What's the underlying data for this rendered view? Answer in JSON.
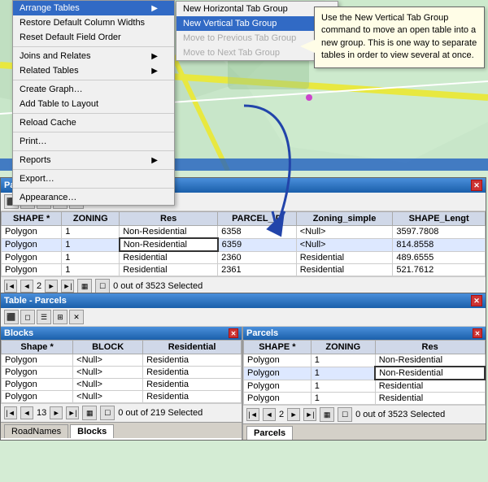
{
  "map": {
    "bg_color": "#c8e6c9"
  },
  "context_menu": {
    "items": [
      {
        "label": "Arrange Tables",
        "has_submenu": true,
        "disabled": false,
        "id": "arrange-tables"
      },
      {
        "label": "Restore Default Column Widths",
        "has_submenu": false,
        "disabled": false,
        "id": "restore-col"
      },
      {
        "label": "Reset Default Field Order",
        "has_submenu": false,
        "disabled": false,
        "id": "reset-field"
      },
      {
        "label": "separator",
        "id": "sep1"
      },
      {
        "label": "Joins and Relates",
        "has_submenu": true,
        "disabled": false,
        "id": "joins-relates"
      },
      {
        "label": "Related Tables",
        "has_submenu": true,
        "disabled": false,
        "id": "related-tables"
      },
      {
        "label": "separator",
        "id": "sep2"
      },
      {
        "label": "Create Graph…",
        "has_submenu": false,
        "disabled": false,
        "id": "create-graph"
      },
      {
        "label": "Add Table to Layout",
        "has_submenu": false,
        "disabled": false,
        "id": "add-table"
      },
      {
        "label": "separator",
        "id": "sep3"
      },
      {
        "label": "Reload Cache",
        "has_submenu": false,
        "disabled": false,
        "id": "reload"
      },
      {
        "label": "separator",
        "id": "sep4"
      },
      {
        "label": "Print…",
        "has_submenu": false,
        "disabled": false,
        "id": "print"
      },
      {
        "label": "separator",
        "id": "sep5"
      },
      {
        "label": "Reports",
        "has_submenu": true,
        "disabled": false,
        "id": "reports"
      },
      {
        "label": "separator",
        "id": "sep6"
      },
      {
        "label": "Export…",
        "has_submenu": false,
        "disabled": false,
        "id": "export"
      },
      {
        "label": "separator",
        "id": "sep7"
      },
      {
        "label": "Appearance…",
        "has_submenu": false,
        "disabled": false,
        "id": "appearance"
      }
    ],
    "submenu_arrange": {
      "items": [
        {
          "label": "New Horizontal Tab Group",
          "disabled": false
        },
        {
          "label": "New Vertical Tab Group",
          "disabled": false,
          "active": true
        },
        {
          "label": "Move to Previous Tab Group",
          "disabled": true
        },
        {
          "label": "Move to Next Tab Group",
          "disabled": true
        }
      ]
    }
  },
  "tooltip": {
    "text": "Use the New Vertical Tab Group command to move an open table into a new group.  This is one way to separate tables in order to view several at once."
  },
  "table_top": {
    "title": "Parcels",
    "columns": [
      "SHAPE *",
      "ZONING",
      "Res",
      "PARCEL_ID",
      "Zoning_simple",
      "SHAPE_Lengt"
    ],
    "rows": [
      [
        "Polygon",
        "1",
        "Non-Residential",
        "6358",
        "<Null>",
        "3597.7808"
      ],
      [
        "Polygon",
        "1",
        "Non-Residential",
        "6359",
        "<Null>",
        "814.8558"
      ],
      [
        "Polygon",
        "1",
        "Residential",
        "2360",
        "Residential",
        "489.6555"
      ],
      [
        "Polygon",
        "1",
        "Residential",
        "2361",
        "Residential",
        "521.7612"
      ]
    ],
    "selected_row": 1,
    "page": "2",
    "total": "3523",
    "selected_count": "0 out of 3523 Selected",
    "tabs": [
      "RoadNames",
      "Blocks",
      "Parcels"
    ]
  },
  "table_bottom": {
    "title": "Table - Parcels",
    "pane_left": {
      "title": "Blocks",
      "columns": [
        "Shape *",
        "BLOCK",
        "Residential"
      ],
      "rows": [
        [
          "Polygon",
          "<Null>",
          "Residentia"
        ],
        [
          "Polygon",
          "<Null>",
          "Residentia"
        ],
        [
          "Polygon",
          "<Null>",
          "Residentia"
        ],
        [
          "Polygon",
          "<Null>",
          "Residentia"
        ]
      ],
      "page": "13",
      "total": "219",
      "selected_count": "0 out of 219 Selected",
      "tabs": [
        "RoadNames",
        "Blocks"
      ]
    },
    "pane_right": {
      "title": "Parcels",
      "columns": [
        "SHAPE *",
        "ZONING",
        "Res"
      ],
      "rows": [
        [
          "Polygon",
          "1",
          "Non-Residential"
        ],
        [
          "Polygon",
          "1",
          "Non-Residential"
        ],
        [
          "Polygon",
          "1",
          "Residential"
        ],
        [
          "Polygon",
          "1",
          "Residential"
        ]
      ],
      "selected_row": 1,
      "page": "2",
      "total": "3523",
      "selected_count": "0 out of 3523 Selected",
      "tabs": [
        "Parcels"
      ]
    }
  },
  "icons": {
    "close": "✕",
    "arrow_right": "▶",
    "nav_first": "|◄",
    "nav_prev": "◄",
    "nav_next": "►",
    "nav_last": "►|",
    "sort_asc": "▲"
  }
}
